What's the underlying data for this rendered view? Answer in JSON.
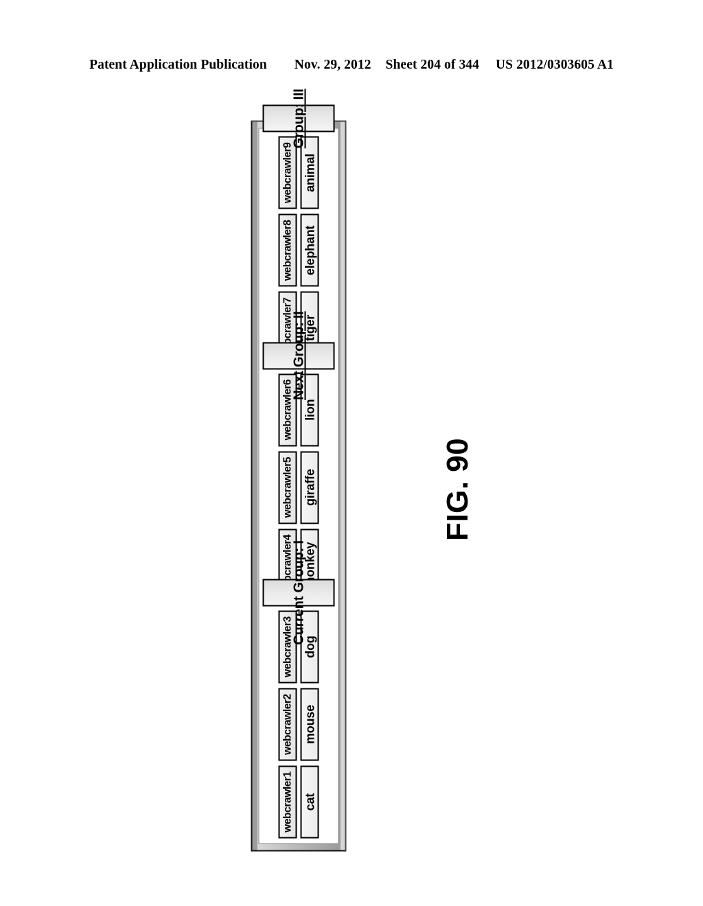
{
  "header": {
    "publication": "Patent Application Publication",
    "date": "Nov. 29, 2012",
    "sheet": "Sheet 204 of 344",
    "doc_number": "US 2012/0303605 A1"
  },
  "figure": {
    "caption": "FIG. 90",
    "rotation_deg": -90,
    "colors": {
      "border": "#000000",
      "chrome": "#bdbdbd",
      "chip_fill": "#eaeaea",
      "page_background": "#ffffff"
    },
    "groups": [
      {
        "id": "group-1",
        "label": "Current Group: I",
        "is_link": false,
        "crawlers": [
          "webcrawler1",
          "webcrawler2",
          "webcrawler3"
        ],
        "animals": [
          "cat",
          "mouse",
          "dog"
        ]
      },
      {
        "id": "group-2",
        "label": "Next Group: II",
        "is_link": true,
        "crawlers": [
          "webcrawler4",
          "webcrawler5",
          "webcrawler6"
        ],
        "animals": [
          "monkey",
          "giraffe",
          "lion"
        ]
      },
      {
        "id": "group-3",
        "label": "Group: III",
        "is_link": true,
        "crawlers": [
          "webcrawler7",
          "webcrawler8",
          "webcrawler9"
        ],
        "animals": [
          "tiger",
          "elephant",
          "animal"
        ]
      }
    ]
  }
}
